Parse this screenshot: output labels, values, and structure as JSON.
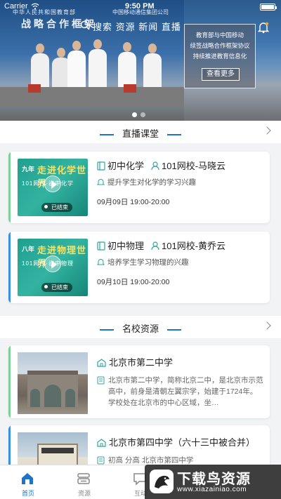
{
  "status_bar": {
    "carrier": "Carrier",
    "time": "9:50 PM"
  },
  "banner": {
    "top_text_left": "中华人民共和国教育部",
    "top_text_right": "中国移动通信集团公司",
    "big_title": "战略合作框架",
    "nav_text": "搜索 资源 新闻 直播",
    "overlay_lines": [
      "教育部与中国移动",
      "续签战略合作框架协议",
      "持续推进教育信息化"
    ],
    "more_button": "查看更多",
    "dot_count": 2,
    "active_dot": 0
  },
  "live_section": {
    "title": "直播课堂",
    "courses": [
      {
        "subject": "初中化学",
        "teacher": "101网校-马晓云",
        "summary": "提升学生对化学的学习兴趣",
        "schedule": "09月09日 19:00-20:00",
        "status": "已结束",
        "thumb_top": "九年",
        "thumb_main": "走进化学世界",
        "thumb_sub": "101网校·初中化学",
        "accent": "#7fcf9a"
      },
      {
        "subject": "初中物理",
        "teacher": "101网校-黄乔云",
        "summary": "培养学生学习物理的兴趣",
        "schedule": "09月10日 19:00-20:00",
        "status": "已结束",
        "thumb_top": "八年",
        "thumb_main": "走进物理世界",
        "thumb_sub": "101网校·初中物理",
        "accent": "#3a8fe0"
      }
    ]
  },
  "school_section": {
    "title": "名校资源",
    "schools": [
      {
        "name": "北京市第二中学",
        "description": "北京市第二中学，简称北京二中，是北京市示范高中，前身是清朝左翼宗学，始建于1724年。学校处在北京市的中心区域，坐…",
        "accent": "#7fcf9a"
      },
      {
        "name": "北京市第四中学（六十三中被合并）",
        "description": "初高 分高 北京市第四中学",
        "accent": "#3a8fe0"
      }
    ]
  },
  "tabbar": {
    "tabs": [
      {
        "label": "首页",
        "icon": "home-icon",
        "active": true
      },
      {
        "label": "资源",
        "icon": "resource-icon",
        "active": false
      },
      {
        "label": "互动",
        "icon": "interact-icon",
        "active": false
      }
    ]
  },
  "watermark": {
    "main": "下载鸟资源",
    "url": "www.xiazainiao.com"
  },
  "colors": {
    "primary": "#1e74c9",
    "green_accent": "#7fcf9a",
    "blue_accent": "#3a8fe0",
    "thumb_teal": "#1fa08f"
  }
}
